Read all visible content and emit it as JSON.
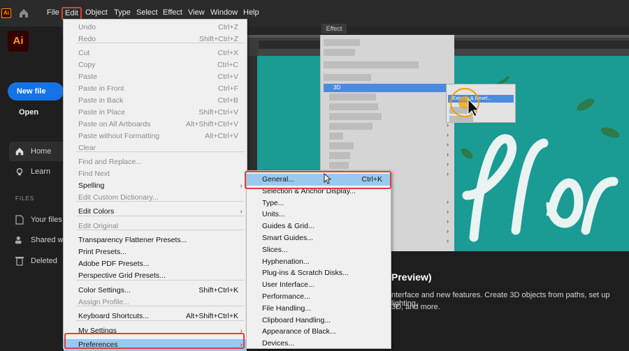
{
  "menubar": {
    "app_icon": "Ai",
    "items": [
      "File",
      "Edit",
      "Object",
      "Type",
      "Select",
      "Effect",
      "View",
      "Window",
      "Help"
    ]
  },
  "home": {
    "logo": "Ai",
    "new_file": "New file",
    "open": "Open",
    "nav": [
      "Home",
      "Learn"
    ],
    "files_header": "FILES",
    "files": [
      "Your files",
      "Shared w",
      "Deleted"
    ]
  },
  "effect_panel_label": "Effect",
  "effect_3d": "3D",
  "effect_extrude": "Extrude & Bevel...",
  "preview": {
    "title": "Preview)",
    "line1": "nterface and new features. Create 3D objects from paths, set up lighting,",
    "line2": "3D, and more."
  },
  "edit_menu": [
    {
      "label": "Undo",
      "shortcut": "Ctrl+Z",
      "enabled": false
    },
    {
      "label": "Redo",
      "shortcut": "Shift+Ctrl+Z",
      "enabled": false
    },
    {
      "sep": true
    },
    {
      "label": "Cut",
      "shortcut": "Ctrl+X",
      "enabled": false
    },
    {
      "label": "Copy",
      "shortcut": "Ctrl+C",
      "enabled": false
    },
    {
      "label": "Paste",
      "shortcut": "Ctrl+V",
      "enabled": false
    },
    {
      "label": "Paste in Front",
      "shortcut": "Ctrl+F",
      "enabled": false
    },
    {
      "label": "Paste in Back",
      "shortcut": "Ctrl+B",
      "enabled": false
    },
    {
      "label": "Paste in Place",
      "shortcut": "Shift+Ctrl+V",
      "enabled": false
    },
    {
      "label": "Paste on All Artboards",
      "shortcut": "Alt+Shift+Ctrl+V",
      "enabled": false
    },
    {
      "label": "Paste without Formatting",
      "shortcut": "Alt+Ctrl+V",
      "enabled": false
    },
    {
      "label": "Clear",
      "shortcut": "",
      "enabled": false
    },
    {
      "sep": true
    },
    {
      "label": "Find and Replace...",
      "shortcut": "",
      "enabled": false
    },
    {
      "label": "Find Next",
      "shortcut": "",
      "enabled": false
    },
    {
      "label": "Spelling",
      "shortcut": "",
      "enabled": true,
      "submenu": true
    },
    {
      "label": "Edit Custom Dictionary...",
      "shortcut": "",
      "enabled": false
    },
    {
      "sep": true
    },
    {
      "label": "Edit Colors",
      "shortcut": "",
      "enabled": true,
      "submenu": true
    },
    {
      "label": "Edit Original",
      "shortcut": "",
      "enabled": false
    },
    {
      "sep": true
    },
    {
      "label": "Transparency Flattener Presets...",
      "shortcut": "",
      "enabled": true
    },
    {
      "label": "Print Presets...",
      "shortcut": "",
      "enabled": true
    },
    {
      "label": "Adobe PDF Presets...",
      "shortcut": "",
      "enabled": true
    },
    {
      "label": "Perspective Grid Presets...",
      "shortcut": "",
      "enabled": true
    },
    {
      "sep": true
    },
    {
      "label": "Color Settings...",
      "shortcut": "Shift+Ctrl+K",
      "enabled": true
    },
    {
      "label": "Assign Profile...",
      "shortcut": "",
      "enabled": false
    },
    {
      "sep": true
    },
    {
      "label": "Keyboard Shortcuts...",
      "shortcut": "Alt+Shift+Ctrl+K",
      "enabled": true
    },
    {
      "sep": true
    },
    {
      "label": "My Settings",
      "shortcut": "",
      "enabled": true,
      "submenu": true
    },
    {
      "sep": true
    },
    {
      "label": "Preferences",
      "shortcut": "",
      "enabled": true,
      "submenu": true,
      "highlighted": true
    }
  ],
  "preferences_menu": [
    {
      "label": "General...",
      "shortcut": "Ctrl+K",
      "highlighted": true
    },
    {
      "label": "Selection & Anchor Display...",
      "shortcut": ""
    },
    {
      "label": "Type...",
      "shortcut": ""
    },
    {
      "label": "Units...",
      "shortcut": ""
    },
    {
      "label": "Guides & Grid...",
      "shortcut": ""
    },
    {
      "label": "Smart Guides...",
      "shortcut": ""
    },
    {
      "label": "Slices...",
      "shortcut": ""
    },
    {
      "label": "Hyphenation...",
      "shortcut": ""
    },
    {
      "label": "Plug-ins & Scratch Disks...",
      "shortcut": ""
    },
    {
      "label": "User Interface...",
      "shortcut": ""
    },
    {
      "label": "Performance...",
      "shortcut": ""
    },
    {
      "label": "File Handling...",
      "shortcut": ""
    },
    {
      "label": "Clipboard Handling...",
      "shortcut": ""
    },
    {
      "label": "Appearance of Black...",
      "shortcut": ""
    },
    {
      "label": "Devices...",
      "shortcut": ""
    }
  ],
  "colors": {
    "accent_blue": "#1473e6",
    "highlight": "#99c9ef",
    "annotation_red": "#e0403a",
    "canvas_teal": "#1a9b94"
  }
}
